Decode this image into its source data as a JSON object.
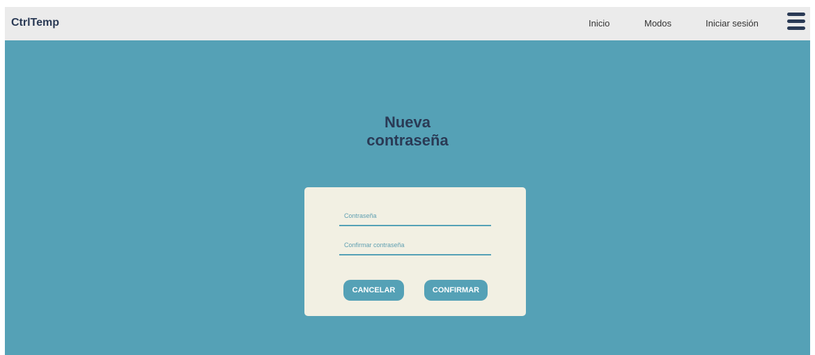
{
  "navbar": {
    "brand": "CtrlTemp",
    "links": [
      "Inicio",
      "Modos",
      "Iniciar sesión"
    ],
    "menu_icon": "hamburger-menu-icon"
  },
  "main": {
    "title_line1": "Nueva",
    "title_line2": "contraseña",
    "form": {
      "password_placeholder": "Contraseña",
      "confirm_placeholder": "Confirmar contraseña",
      "cancel_label": "CANCELAR",
      "confirm_label": "CONFIRMAR"
    }
  },
  "colors": {
    "background": "#55a1b6",
    "navbar": "#ebebeb",
    "card": "#f2f0e3",
    "text_dark": "#2a3a55"
  }
}
